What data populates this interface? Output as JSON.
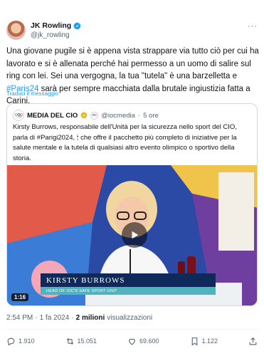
{
  "author": {
    "name": "JK Rowling",
    "handle": "@jk_rowling"
  },
  "more_label": "···",
  "tweet": {
    "text_1": "Una giovane pugile si è appena vista strappare via tutto ciò per cui ha lavorato e si è allenata perché hai permesso a un uomo di salire sul ring con lei. Sei una vergogna, la tua \"tutela\" è una barzelletta e ",
    "hashtag": "#Paris24",
    "text_2": " sarà per sempre macchiata dalla brutale ingiustizia fatta a Carini.",
    "translate_label": "Traduci il messaggio"
  },
  "quote": {
    "name": "MEDIA DEL CIO",
    "handle": "@iocmedia",
    "separator": "·",
    "time": "5 ore",
    "text": "Kirsty Burrows, responsabile dell'Unità per la sicurezza nello sport del CIO, parla di #Parigi2024, 🕯 che offre il pacchetto più completo di iniziative per la salute mentale e la tutela di qualsiasi altro evento olimpico o sportivo della storia.",
    "video": {
      "lower_third_name": "KIRSTY BURROWS",
      "lower_third_title": "HEAD OF IOC'S SAFE SPORT UNIT",
      "duration": "1:16"
    }
  },
  "meta": {
    "time": "2:54 PM",
    "dot1": "·",
    "date": "1 fa 2024",
    "dot2": "·",
    "views_count": "2 milioni",
    "views_label": "visualizzazioni"
  },
  "actions": {
    "replies": "1.910",
    "reposts": "15.051",
    "likes": "69.600",
    "bookmarks": "1.122"
  },
  "colors": {
    "accent": "#1d9bf0",
    "text": "#0f1419",
    "secondary": "#536471"
  }
}
